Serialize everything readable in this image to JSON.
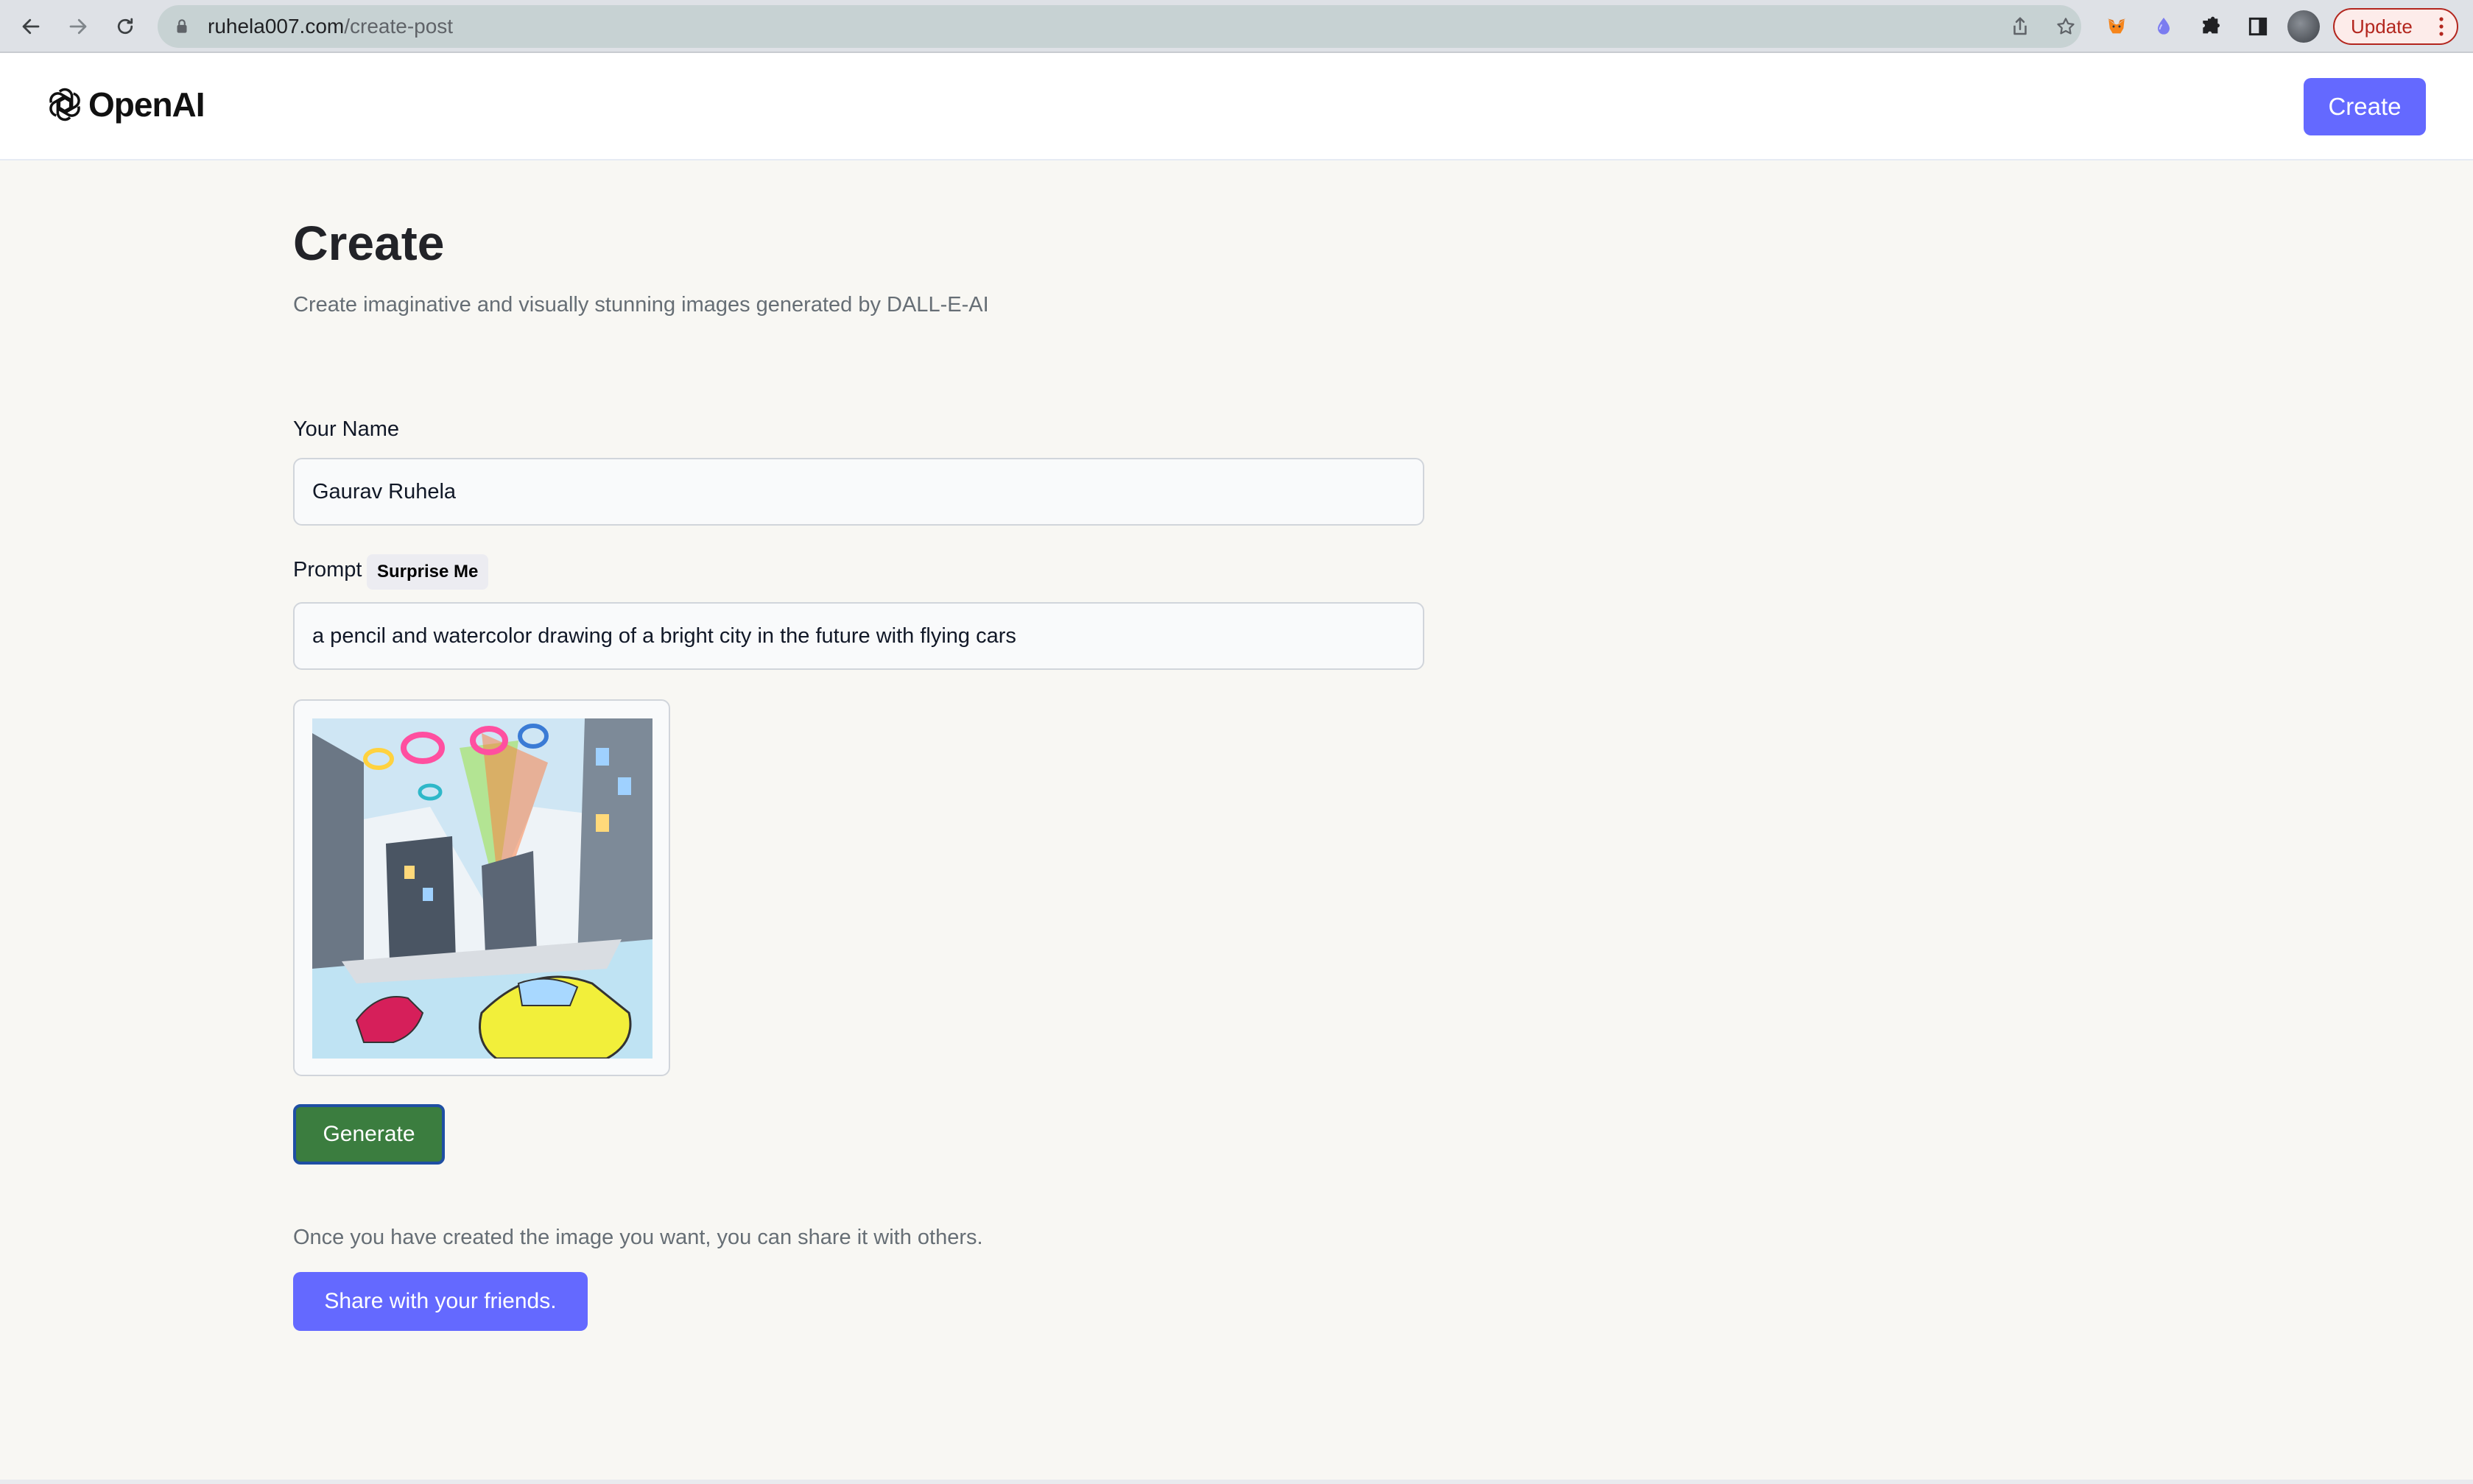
{
  "browser": {
    "url_host": "ruhela007.com",
    "url_path": "/create-post",
    "update_label": "Update"
  },
  "header": {
    "brand": "OpenAI",
    "create_label": "Create"
  },
  "main": {
    "title": "Create",
    "subtitle": "Create imaginative and visually stunning images generated by DALL-E-AI",
    "name_label": "Your Name",
    "name_value": "Gaurav Ruhela",
    "prompt_label": "Prompt",
    "surprise_label": "Surprise Me",
    "prompt_value": "a pencil and watercolor drawing of a bright city in the future with flying cars",
    "generate_label": "Generate",
    "share_note": "Once you have created the image you want, you can share it with others.",
    "share_label": "Share with your friends."
  },
  "colors": {
    "accent": "#6469ff",
    "generate": "#3b7d3f",
    "background": "#f8f7f3"
  },
  "icons": [
    "back-arrow-icon",
    "forward-arrow-icon",
    "reload-icon",
    "lock-icon",
    "share-icon",
    "bookmark-star-icon",
    "metamask-fox-icon",
    "extension-drop-icon",
    "puzzle-extensions-icon",
    "side-panel-icon",
    "kebab-menu-icon",
    "openai-logo-icon"
  ]
}
